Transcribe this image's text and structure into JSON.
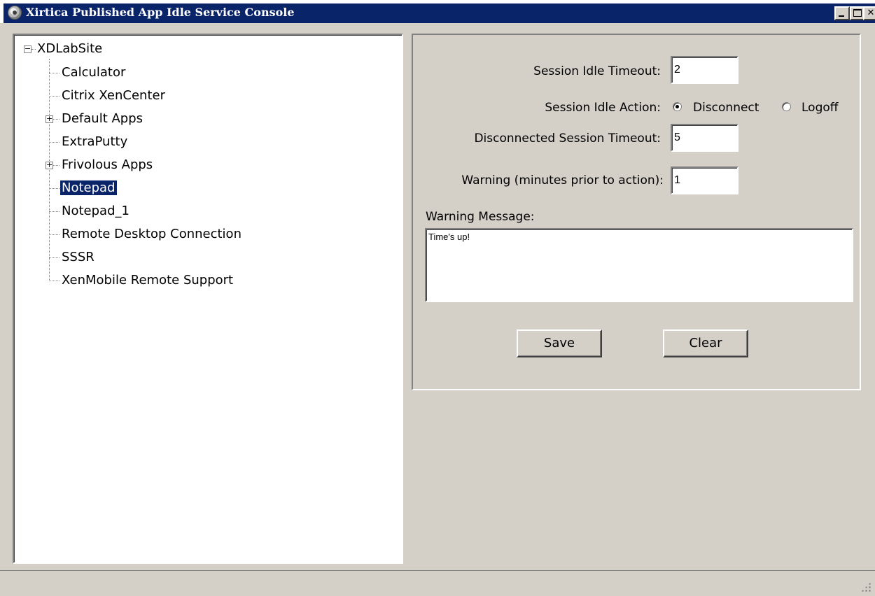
{
  "window": {
    "title": "Xirtica Published App Idle Service Console",
    "controls": {
      "minimize": "_",
      "maximize": "□",
      "close": "✕"
    }
  },
  "tree": {
    "root": {
      "label": "XDLabSite",
      "expanded": true
    },
    "items": [
      {
        "label": "Calculator",
        "expandable": false
      },
      {
        "label": "Citrix XenCenter",
        "expandable": false
      },
      {
        "label": "Default Apps",
        "expandable": true,
        "expanded": false
      },
      {
        "label": "ExtraPutty",
        "expandable": false
      },
      {
        "label": "Frivolous Apps",
        "expandable": true,
        "expanded": false
      },
      {
        "label": "Notepad",
        "expandable": false,
        "selected": true
      },
      {
        "label": "Notepad_1",
        "expandable": false
      },
      {
        "label": "Remote Desktop Connection",
        "expandable": false
      },
      {
        "label": "SSSR",
        "expandable": false
      },
      {
        "label": "XenMobile Remote Support",
        "expandable": false
      }
    ],
    "expander_collapsed": "+",
    "expander_expanded": "−"
  },
  "settings": {
    "idle_timeout_label": "Session Idle Timeout:",
    "idle_timeout_value": "2",
    "idle_action_label": "Session Idle Action:",
    "idle_action_options": [
      "Disconnect",
      "Logoff"
    ],
    "idle_action_selected": "Disconnect",
    "disconnected_timeout_label": "Disconnected Session Timeout:",
    "disconnected_timeout_value": "5",
    "warning_label": "Warning (minutes prior to action):",
    "warning_value": "1",
    "warning_message_label": "Warning Message:",
    "warning_message_value": "Time's up!",
    "save_label": "Save",
    "clear_label": "Clear"
  },
  "colors": {
    "titlebar": "#0a246a",
    "selection": "#0a246a",
    "face": "#d4d0c8"
  }
}
